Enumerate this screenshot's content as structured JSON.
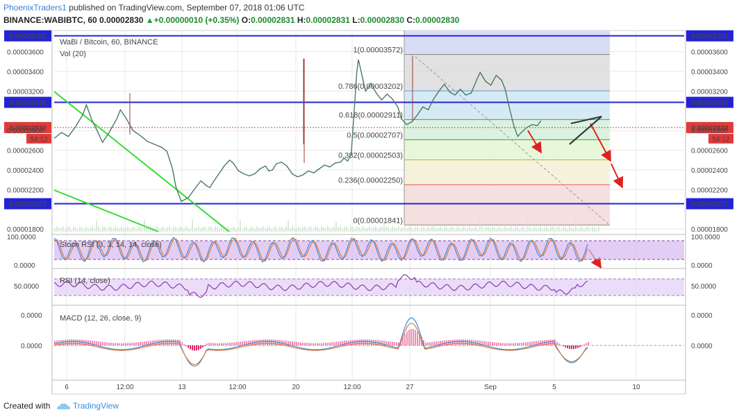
{
  "header": {
    "author": "PhoenixTraders1",
    "published_text": " published on TradingView.com, September 07, 2018 01:06 UTC",
    "symbol": "BINANCE:WABIBTC, 60",
    "price": "0.00002830",
    "change": "+0.00000010 (+0.35%)",
    "o_label": "O:",
    "o": "0.00002831",
    "h_label": "H:",
    "h": "0.00002831",
    "l_label": "L:",
    "l": "0.00002830",
    "c_label": "C:",
    "c": "0.00002830"
  },
  "footer": {
    "created_with": "Created with",
    "brand": "TradingView"
  },
  "chart_data": {
    "type": "line",
    "title": "WaBi / Bitcoin, 60, BINANCE",
    "volume_label": "Vol (20)",
    "y_ticks": [
      "0.00003600",
      "0.00003400",
      "0.00003200",
      "0.00002800",
      "0.00002600",
      "0.00002400",
      "0.00002200",
      "0.00001800"
    ],
    "y_range": [
      1.773e-05,
      3.815e-05
    ],
    "x_ticks": [
      "6",
      "12:00",
      "13",
      "12:00",
      "20",
      "12:00",
      "27",
      "Sep",
      "5",
      "10"
    ],
    "series": [
      {
        "values": [
          [
            0,
            2.72e-05
          ],
          [
            4,
            2.78e-05
          ],
          [
            8,
            2.74e-05
          ],
          [
            12,
            2.84e-05
          ],
          [
            16,
            2.96e-05
          ],
          [
            18,
            3.06e-05
          ],
          [
            21,
            2.91e-05
          ],
          [
            25,
            2.76e-05
          ],
          [
            27,
            2.68e-05
          ],
          [
            31,
            2.79e-05
          ],
          [
            35,
            2.92e-05
          ],
          [
            37,
            3.01e-05
          ],
          [
            40,
            2.93e-05
          ],
          [
            44,
            2.8e-05
          ],
          [
            48,
            2.75e-05
          ],
          [
            52,
            2.69e-05
          ],
          [
            56,
            2.66e-05
          ],
          [
            60,
            2.63e-05
          ],
          [
            63,
            2.59e-05
          ],
          [
            66,
            2.42e-05
          ],
          [
            68,
            2.23e-05
          ],
          [
            71,
            2.08e-05
          ],
          [
            75,
            2.12e-05
          ],
          [
            79,
            2.22e-05
          ],
          [
            82,
            2.29e-05
          ],
          [
            85,
            2.24e-05
          ],
          [
            87,
            2.22e-05
          ],
          [
            89,
            2.28e-05
          ],
          [
            92,
            2.36e-05
          ],
          [
            95,
            2.44e-05
          ],
          [
            98,
            2.5e-05
          ],
          [
            100,
            2.47e-05
          ],
          [
            103,
            2.39e-05
          ],
          [
            106,
            2.36e-05
          ],
          [
            109,
            2.34e-05
          ],
          [
            112,
            2.36e-05
          ],
          [
            115,
            2.41e-05
          ],
          [
            118,
            2.44e-05
          ],
          [
            120,
            2.39e-05
          ],
          [
            122,
            2.4e-05
          ],
          [
            124,
            2.46e-05
          ],
          [
            127,
            2.48e-05
          ],
          [
            130,
            2.44e-05
          ],
          [
            133,
            2.36e-05
          ],
          [
            136,
            2.33e-05
          ],
          [
            139,
            2.35e-05
          ],
          [
            142,
            2.39e-05
          ],
          [
            145,
            2.37e-05
          ],
          [
            148,
            2.41e-05
          ],
          [
            151,
            2.45e-05
          ],
          [
            154,
            2.43e-05
          ],
          [
            157,
            2.47e-05
          ],
          [
            160,
            2.48e-05
          ],
          [
            162,
            2.52e-05
          ],
          [
            164,
            2.49e-05
          ],
          [
            166,
            2.56e-05
          ],
          [
            168,
            3.1e-05
          ],
          [
            169,
            3.38e-05
          ],
          [
            170,
            3.52e-05
          ],
          [
            172,
            3.36e-05
          ],
          [
            174,
            3.2e-05
          ],
          [
            177,
            3.28e-05
          ],
          [
            180,
            3.18e-05
          ],
          [
            183,
            3.11e-05
          ],
          [
            186,
            3.17e-05
          ],
          [
            189,
            3.12e-05
          ],
          [
            192,
            3.04e-05
          ],
          [
            194,
            2.92e-05
          ],
          [
            197,
            2.86e-05
          ],
          [
            200,
            2.89e-05
          ],
          [
            203,
            2.96e-05
          ],
          [
            206,
            3.04e-05
          ],
          [
            209,
            3.01e-05
          ],
          [
            212,
            3.12e-05
          ],
          [
            215,
            3.2e-05
          ],
          [
            218,
            3.27e-05
          ],
          [
            221,
            3.19e-05
          ],
          [
            224,
            3.16e-05
          ],
          [
            227,
            3.22e-05
          ],
          [
            230,
            3.16e-05
          ],
          [
            233,
            3.18e-05
          ],
          [
            236,
            3.31e-05
          ],
          [
            238,
            3.39e-05
          ],
          [
            241,
            3.3e-05
          ],
          [
            244,
            3.26e-05
          ],
          [
            247,
            3.36e-05
          ],
          [
            250,
            3.31e-05
          ],
          [
            252,
            3.22e-05
          ],
          [
            255,
            2.98e-05
          ],
          [
            257,
            2.84e-05
          ],
          [
            259,
            2.74e-05
          ],
          [
            261,
            2.78e-05
          ],
          [
            264,
            2.83e-05
          ],
          [
            267,
            2.86e-05
          ],
          [
            270,
            2.85e-05
          ],
          [
            272,
            2.9e-05
          ]
        ]
      }
    ],
    "x_span": [
      0,
      352
    ],
    "horizontal_levels": [
      {
        "label": "0.00003761",
        "value": 3.761e-05,
        "color": "#2323d6"
      },
      {
        "label": "0.00003086",
        "value": 3.086e-05,
        "color": "#2323d6"
      },
      {
        "label": "0.00002057",
        "value": 2.057e-05,
        "color": "#2323d6"
      }
    ],
    "current_price": {
      "label": "0.00002830",
      "value": 2.83e-05,
      "countdown": "54:12",
      "color": "#e03a3a"
    },
    "fib_levels": [
      {
        "label": "1(0.00003572)",
        "value": 3.572e-05,
        "fill": "#d9dcf6",
        "text": "#888888"
      },
      {
        "label": "0.786(0.00003202)",
        "value": 3.202e-05,
        "fill": "#dcdcdc",
        "text": "#5a9bd6"
      },
      {
        "label": "0.618(0.00002911)",
        "value": 2.911e-05,
        "fill": "#cfe6f3",
        "text": "#2aa198"
      },
      {
        "label": "0.5(0.00002707)",
        "value": 2.707e-05,
        "fill": "#d5f0db",
        "text": "#3aa53a"
      },
      {
        "label": "0.382(0.00002503)",
        "value": 2.503e-05,
        "fill": "#e4f4d2",
        "text": "#8bc34a"
      },
      {
        "label": "0.236(0.00002250)",
        "value": 2.25e-05,
        "fill": "#f5f0d6",
        "text": "#e05a5a"
      },
      {
        "label": "0(0.00001841)",
        "value": 1.841e-05,
        "fill": "#f4d9d9",
        "text": "#888888"
      }
    ],
    "indicators": {
      "stoch_rsi": {
        "label": "Stoch RSI (3, 3, 14, 14, close)",
        "ticks": [
          "100.0000",
          "0.0000"
        ]
      },
      "rsi": {
        "label": "RSI (14, close)",
        "ticks": [
          "50.0000"
        ]
      },
      "macd": {
        "label": "MACD (12, 26, close, 9)",
        "ticks": [
          "0.0000",
          "0.0000"
        ]
      }
    },
    "colors": {
      "bull": "#3a9a5c",
      "bear": "#9c3a3a",
      "grid": "#e8e8e8",
      "fib_line": "#999999",
      "trend": "#33dd33",
      "arrow": "#e02020"
    }
  }
}
